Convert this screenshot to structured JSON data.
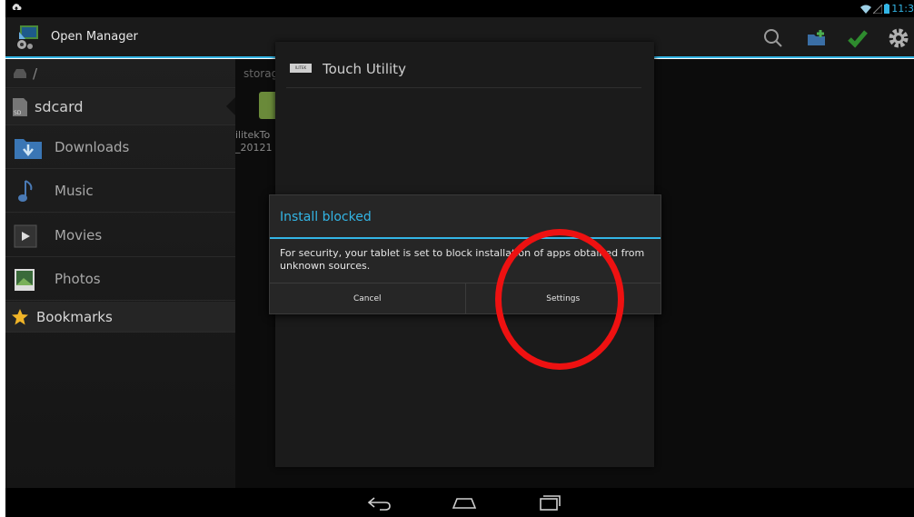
{
  "status_bar": {
    "clock": "11:3"
  },
  "action_bar": {
    "app_title": "Open Manager",
    "actions": [
      "search-icon",
      "new-folder-icon",
      "checkmark-icon",
      "settings-icon"
    ]
  },
  "sidebar": {
    "root_path": "/",
    "storage_label": "sdcard",
    "items": [
      {
        "label": "Downloads",
        "icon": "downloads-icon"
      },
      {
        "label": "Music",
        "icon": "music-icon"
      },
      {
        "label": "Movies",
        "icon": "movies-icon"
      },
      {
        "label": "Photos",
        "icon": "photos-icon"
      }
    ],
    "bookmarks_label": "Bookmarks"
  },
  "content": {
    "breadcrumb": "storag",
    "file_name": "ilitekTo\n_20121"
  },
  "touch_utility": {
    "title": "Touch Utility",
    "icon_text": "ILITEK"
  },
  "install_dialog": {
    "title": "Install blocked",
    "message": "For security, your tablet is set to block installation of apps obtained from unknown sources.",
    "cancel_label": "Cancel",
    "settings_label": "Settings"
  },
  "colors": {
    "accent": "#33b5e5",
    "annotation": "#ee1111"
  }
}
